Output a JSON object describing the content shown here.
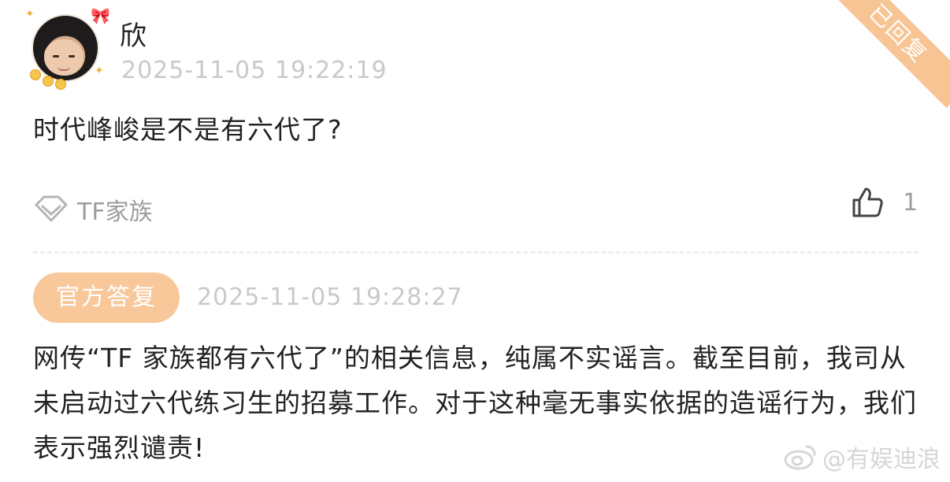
{
  "comment": {
    "username": "欣",
    "timestamp": "2025-11-05 19:22:19",
    "text": "时代峰峻是不是有六代了?",
    "tag_label": "TF家族",
    "like_count": "1"
  },
  "corner_label": "已回复",
  "reply": {
    "badge": "官方答复",
    "timestamp": "2025-11-05 19:28:27",
    "text": "网传“TF 家族都有六代了”的相关信息，纯属不实谣言。截至目前，我司从未启动过六代练习生的招募工作。对于这种毫无事实依据的造谣行为，我们表示强烈谴责!"
  },
  "watermark": "@有娱迪浪",
  "colors": {
    "accent": "#f8c89b",
    "muted_text": "#c9c9c9",
    "body_text": "#222222"
  }
}
